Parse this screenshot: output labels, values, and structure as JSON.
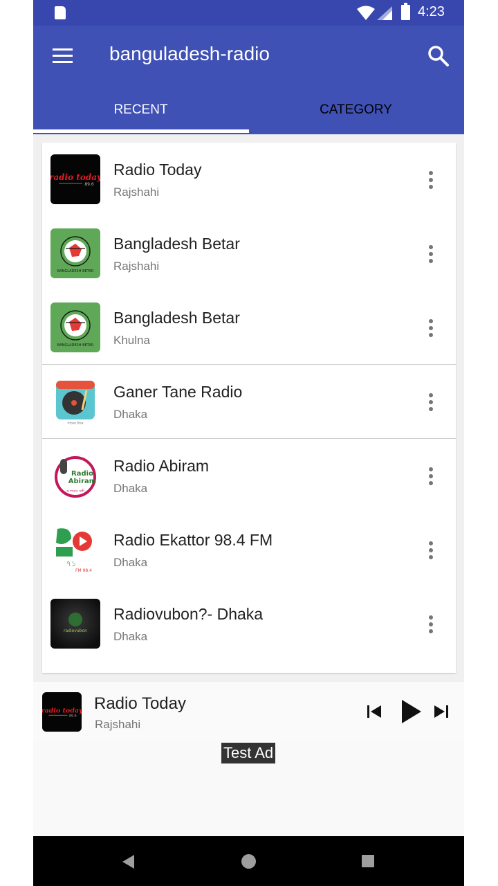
{
  "status_bar": {
    "time": "4:23"
  },
  "app_bar": {
    "title": "banguladesh-radio"
  },
  "tabs": [
    {
      "label": "RECENT",
      "active": true
    },
    {
      "label": "CATEGORY",
      "active": false
    }
  ],
  "stations": [
    {
      "name": "Radio Today",
      "location": "Rajshahi",
      "logo": "radio-today-logo"
    },
    {
      "name": "Bangladesh Betar",
      "location": "Rajshahi",
      "logo": "bangladesh-betar-logo"
    },
    {
      "name": "Bangladesh Betar",
      "location": "Khulna",
      "logo": "bangladesh-betar-logo"
    },
    {
      "name": "Ganer Tane Radio",
      "location": "Dhaka",
      "logo": "turntable-logo"
    },
    {
      "name": "Radio Abiram",
      "location": "Dhaka",
      "logo": "radio-abiram-logo"
    },
    {
      "name": "Radio Ekattor 98.4 FM",
      "location": "Dhaka",
      "logo": "radio-ekattor-logo"
    },
    {
      "name": "Radiovubon?- Dhaka",
      "location": "Dhaka",
      "logo": "radiovubon-logo"
    }
  ],
  "player": {
    "title": "Radio Today",
    "subtitle": "Rajshahi"
  },
  "ad": {
    "label": "Test Ad"
  },
  "colors": {
    "primary": "#3f51b5",
    "primary_dark": "#3747ad",
    "betar_green": "#5fa858",
    "accent_red": "#e53935"
  }
}
